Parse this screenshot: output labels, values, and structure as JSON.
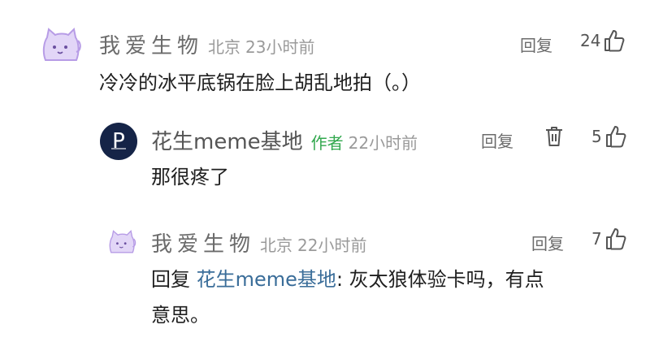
{
  "comments": [
    {
      "user": "我爱生物",
      "location": "北京",
      "time": "23小时前",
      "text": "冷冷的冰平底锅在脸上胡乱地拍（。）",
      "reply_label": "回复",
      "likes": "24",
      "avatar": "cat-avatar"
    },
    {
      "user": "花生meme基地",
      "author_tag": "作者",
      "time": "22小时前",
      "text": "那很疼了",
      "reply_label": "回复",
      "likes": "5",
      "avatar_letter": "P"
    },
    {
      "user": "我爱生物",
      "location": "北京",
      "time": "22小时前",
      "reply_prefix": "回复",
      "mention": "花生meme基地",
      "text_line1": ": 灰太狼体验卡吗，有点",
      "text_line2": "意思。",
      "reply_label": "回复",
      "likes": "7",
      "avatar": "cat-avatar"
    }
  ],
  "icons": {
    "like": "thumbs-up-icon",
    "delete": "trash-icon",
    "avatar": "cat-avatar-icon"
  },
  "colors": {
    "author_tag": "#32a84e",
    "mention": "#3a6d99",
    "avatar_bg": "#152447",
    "cat": "#c9b3ec"
  }
}
